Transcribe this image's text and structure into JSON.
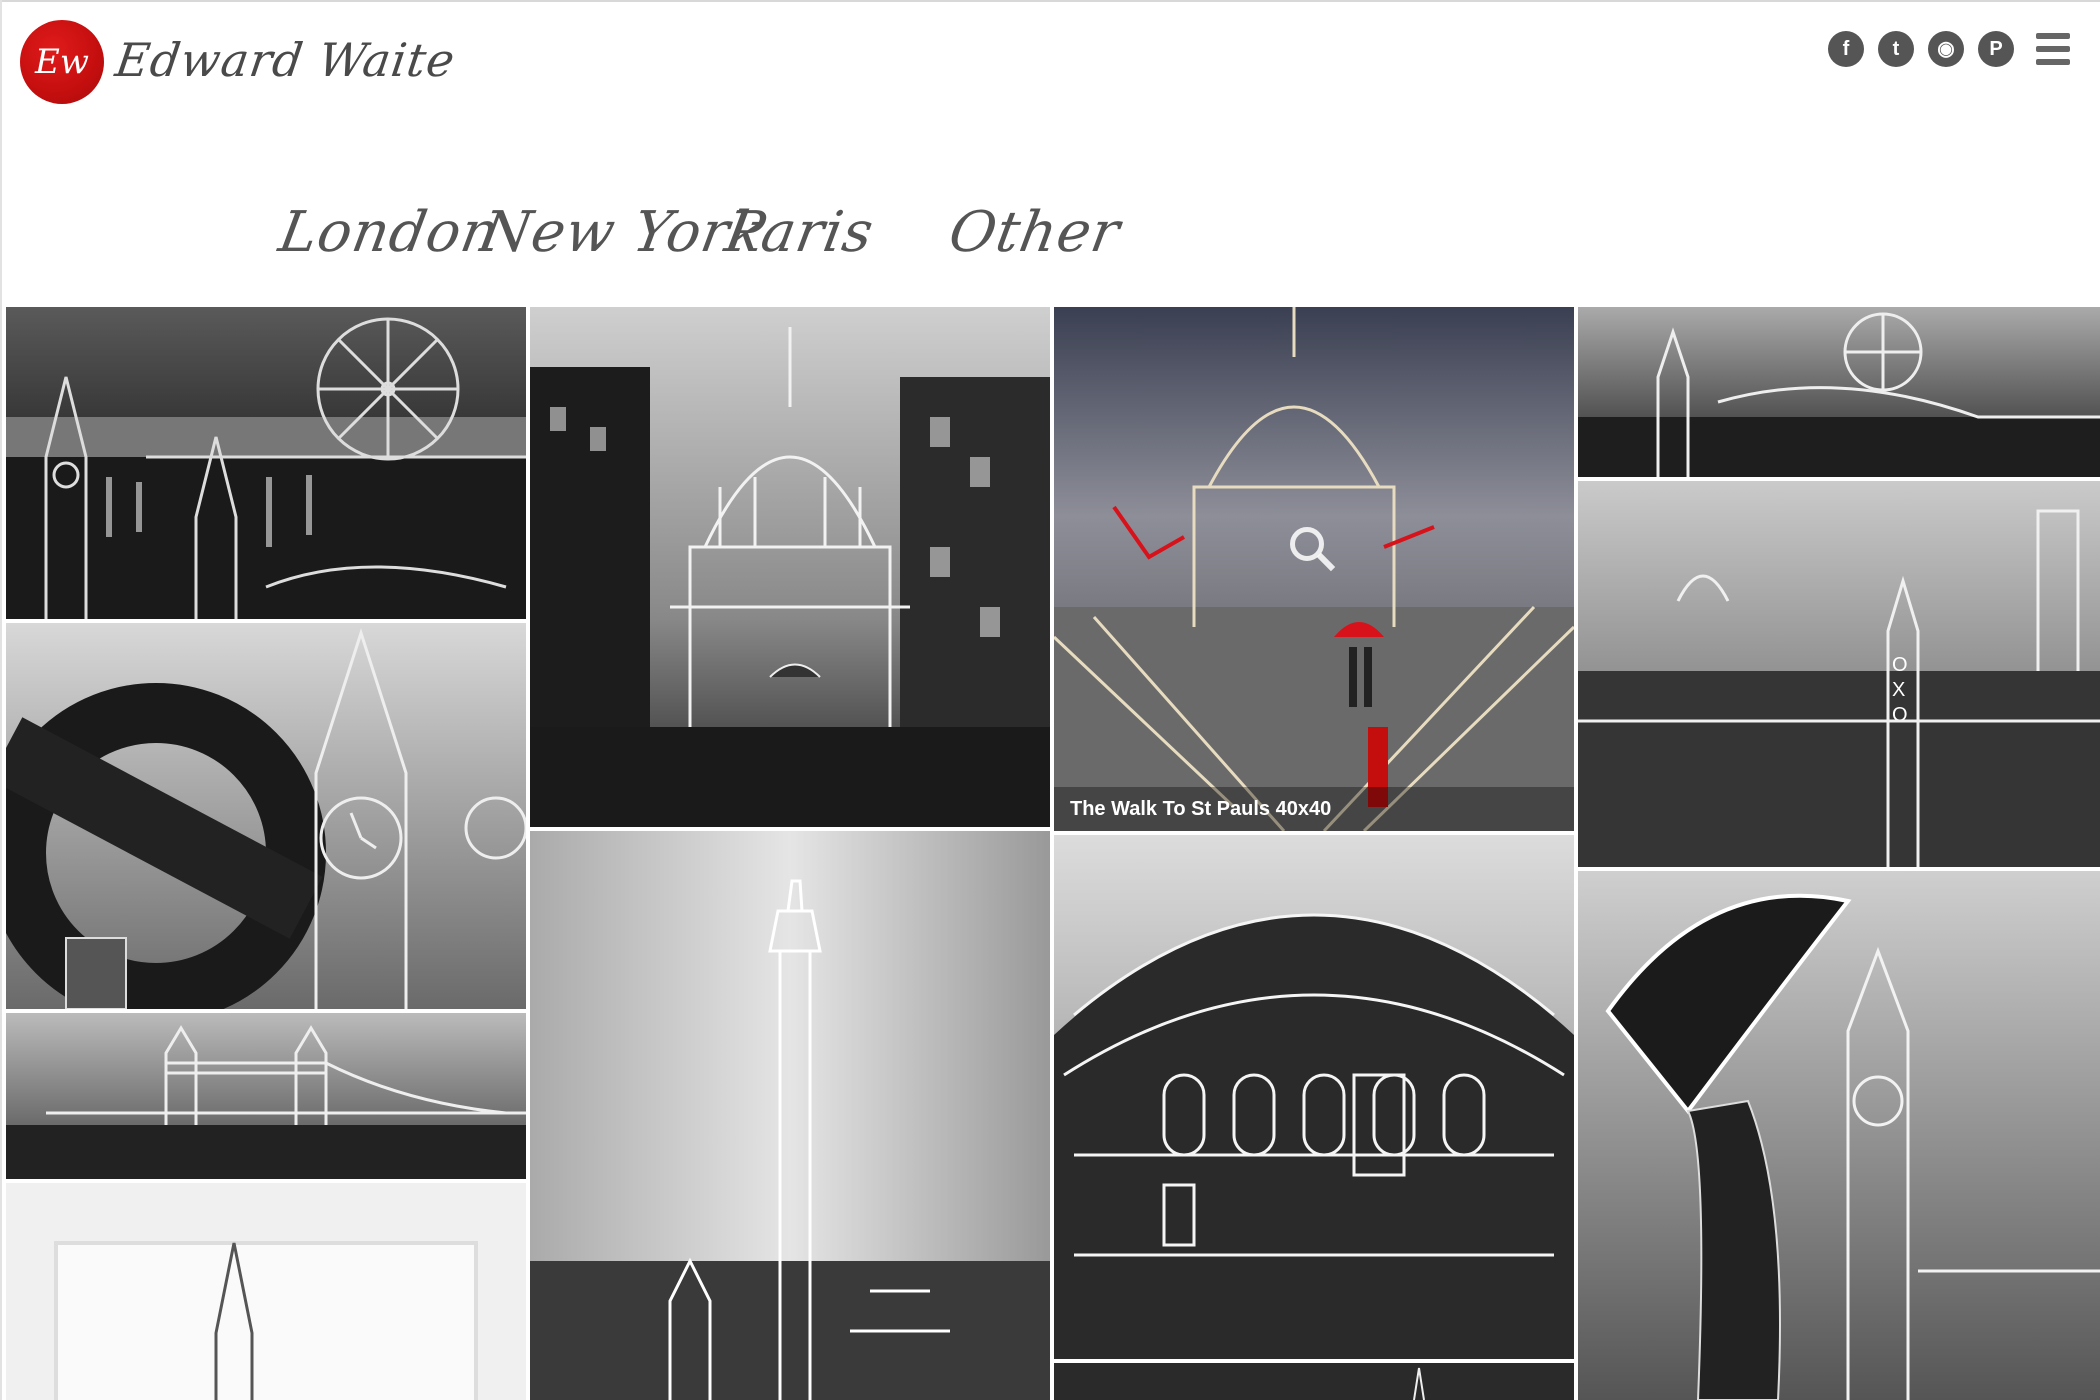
{
  "header": {
    "logo_mark": "Ew",
    "site_name": "Edward Waite",
    "social": [
      {
        "name": "facebook-icon",
        "glyph": "f"
      },
      {
        "name": "twitter-icon",
        "glyph": "t"
      },
      {
        "name": "instagram-icon",
        "glyph": "◉"
      },
      {
        "name": "pinterest-icon",
        "glyph": "P"
      }
    ],
    "menu_icon": "hamburger-menu-icon"
  },
  "nav": {
    "items": [
      "London",
      "New York",
      "Paris",
      "Other"
    ]
  },
  "gallery": {
    "featured_caption": "The Walk To St Pauls 40x40"
  },
  "colors": {
    "brand_red": "#c40e0e",
    "icon_gray": "#555555",
    "nav_text": "#555555"
  }
}
